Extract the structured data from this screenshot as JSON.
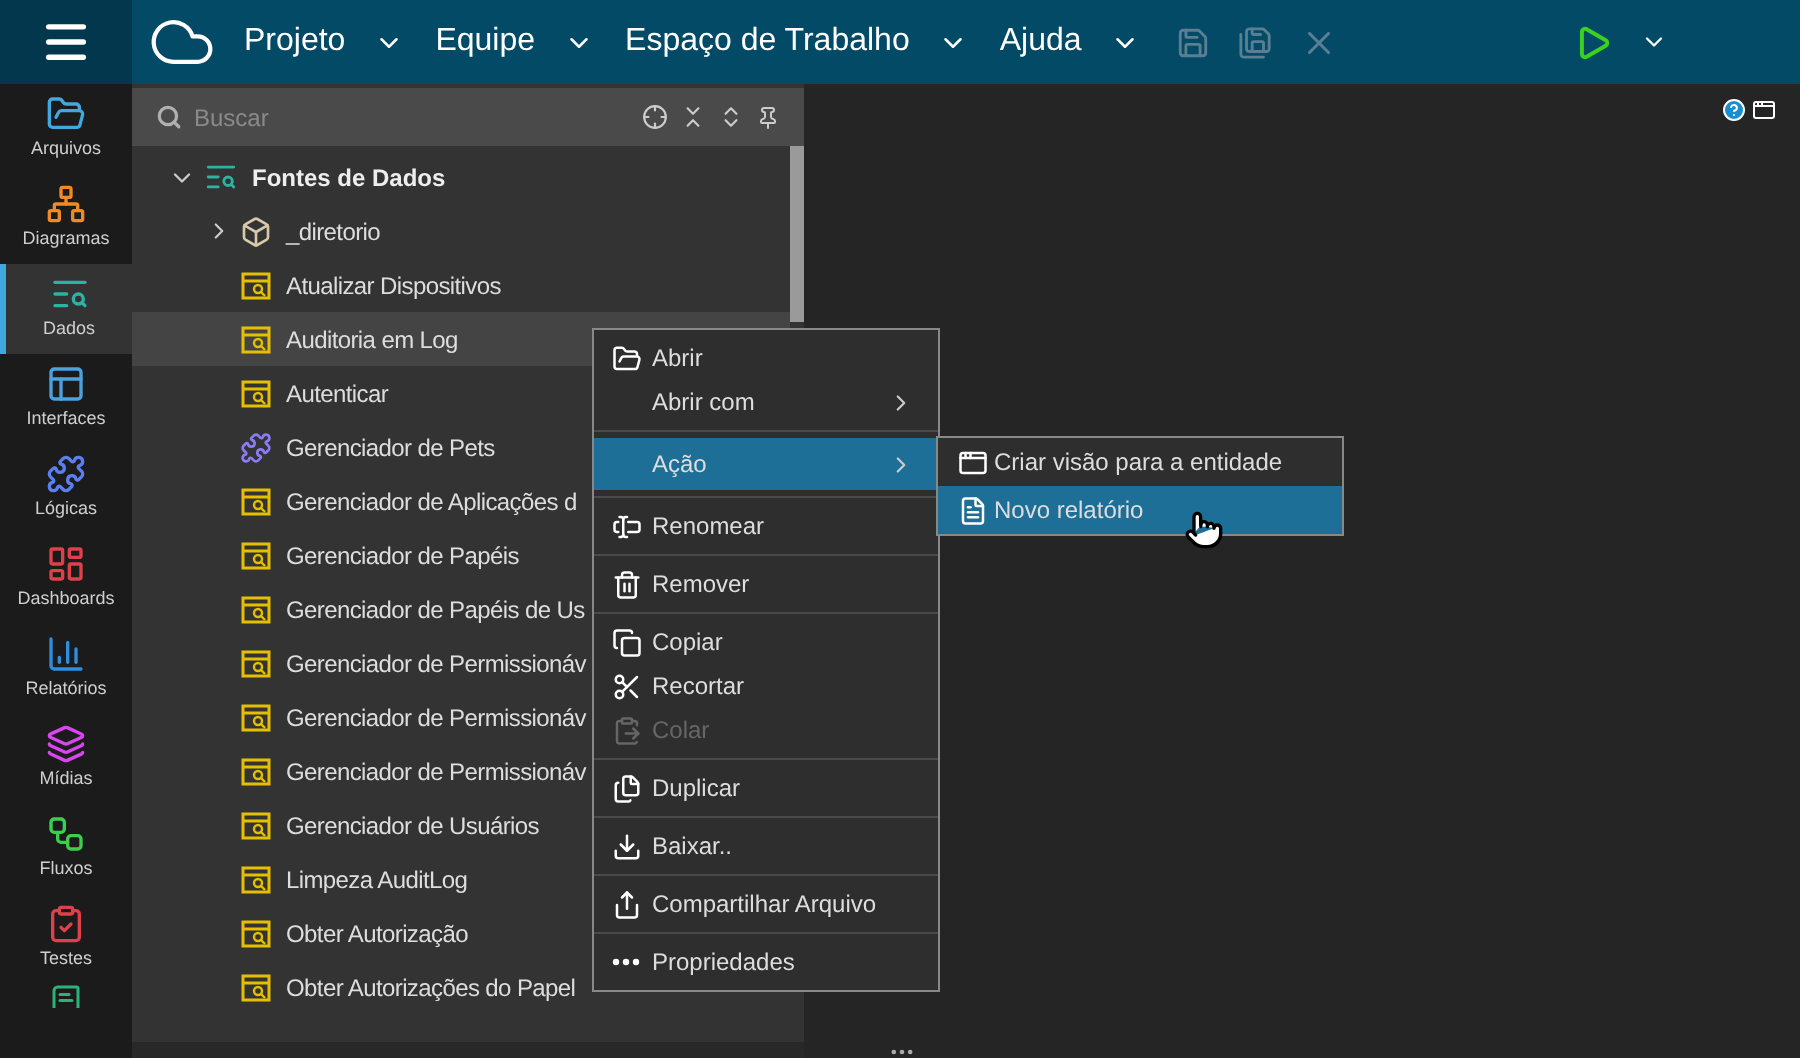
{
  "top_menu": [
    {
      "label": "Projeto"
    },
    {
      "label": "Equipe"
    },
    {
      "label": "Espaço de Trabalho"
    },
    {
      "label": "Ajuda"
    }
  ],
  "toolbar": {
    "save_disabled": true,
    "save_all_disabled": true,
    "close_disabled": true
  },
  "sidebar": {
    "items": [
      {
        "label": "Arquivos",
        "selected": false
      },
      {
        "label": "Diagramas",
        "selected": false
      },
      {
        "label": "Dados",
        "selected": true
      },
      {
        "label": "Interfaces",
        "selected": false
      },
      {
        "label": "Lógicas",
        "selected": false
      },
      {
        "label": "Dashboards",
        "selected": false
      },
      {
        "label": "Relatórios",
        "selected": false
      },
      {
        "label": "Mídias",
        "selected": false
      },
      {
        "label": "Fluxos",
        "selected": false
      },
      {
        "label": "Testes",
        "selected": false
      }
    ]
  },
  "search": {
    "placeholder": "Buscar"
  },
  "tree": {
    "label": "Fontes de Dados",
    "kind": "group",
    "expanded": true,
    "children": [
      {
        "label": "_diretorio",
        "kind": "folder",
        "expanded": false,
        "selected": false
      },
      {
        "label": "Atualizar Dispositivos",
        "kind": "query",
        "selected": false
      },
      {
        "label": "Auditoria em Log",
        "kind": "query",
        "selected": true
      },
      {
        "label": "Autenticar",
        "kind": "query",
        "selected": false
      },
      {
        "label": "Gerenciador de Pets",
        "kind": "logic",
        "selected": false
      },
      {
        "label": "Gerenciador de Aplicações d",
        "kind": "query",
        "selected": false
      },
      {
        "label": "Gerenciador de Papéis",
        "kind": "query",
        "selected": false
      },
      {
        "label": "Gerenciador de Papéis de Us",
        "kind": "query",
        "selected": false
      },
      {
        "label": "Gerenciador de Permissionáv",
        "kind": "query",
        "selected": false
      },
      {
        "label": "Gerenciador de Permissionáv",
        "kind": "query",
        "selected": false
      },
      {
        "label": "Gerenciador de Permissionáv",
        "kind": "query",
        "selected": false
      },
      {
        "label": "Gerenciador de Usuários",
        "kind": "query",
        "selected": false
      },
      {
        "label": "Limpeza AuditLog",
        "kind": "query",
        "selected": false
      },
      {
        "label": "Obter Autorização",
        "kind": "query",
        "selected": false
      },
      {
        "label": "Obter Autorizações do Papel",
        "kind": "query",
        "selected": false
      }
    ]
  },
  "context_menu": {
    "groups": [
      [
        {
          "label": "Abrir",
          "submenu": false,
          "selected": false,
          "disabled": false
        },
        {
          "label": "Abrir com",
          "submenu": true,
          "selected": false,
          "disabled": false
        }
      ],
      [
        {
          "label": "Ação",
          "submenu": true,
          "selected": true,
          "disabled": false
        }
      ],
      [
        {
          "label": "Renomear",
          "submenu": false,
          "selected": false,
          "disabled": false
        }
      ],
      [
        {
          "label": "Remover",
          "submenu": false,
          "selected": false,
          "disabled": false
        }
      ],
      [
        {
          "label": "Copiar",
          "submenu": false,
          "selected": false,
          "disabled": false
        },
        {
          "label": "Recortar",
          "submenu": false,
          "selected": false,
          "disabled": false
        },
        {
          "label": "Colar",
          "submenu": false,
          "selected": false,
          "disabled": true
        }
      ],
      [
        {
          "label": "Duplicar",
          "submenu": false,
          "selected": false,
          "disabled": false
        }
      ],
      [
        {
          "label": "Baixar..",
          "submenu": false,
          "selected": false,
          "disabled": false
        }
      ],
      [
        {
          "label": "Compartilhar Arquivo",
          "submenu": false,
          "selected": false,
          "disabled": false
        }
      ],
      [
        {
          "label": "Propriedades",
          "submenu": false,
          "selected": false,
          "disabled": false
        }
      ]
    ]
  },
  "submenu": {
    "items": [
      {
        "label": "Criar visão para a entidade",
        "selected": false
      },
      {
        "label": "Novo relatório",
        "selected": true
      }
    ]
  }
}
